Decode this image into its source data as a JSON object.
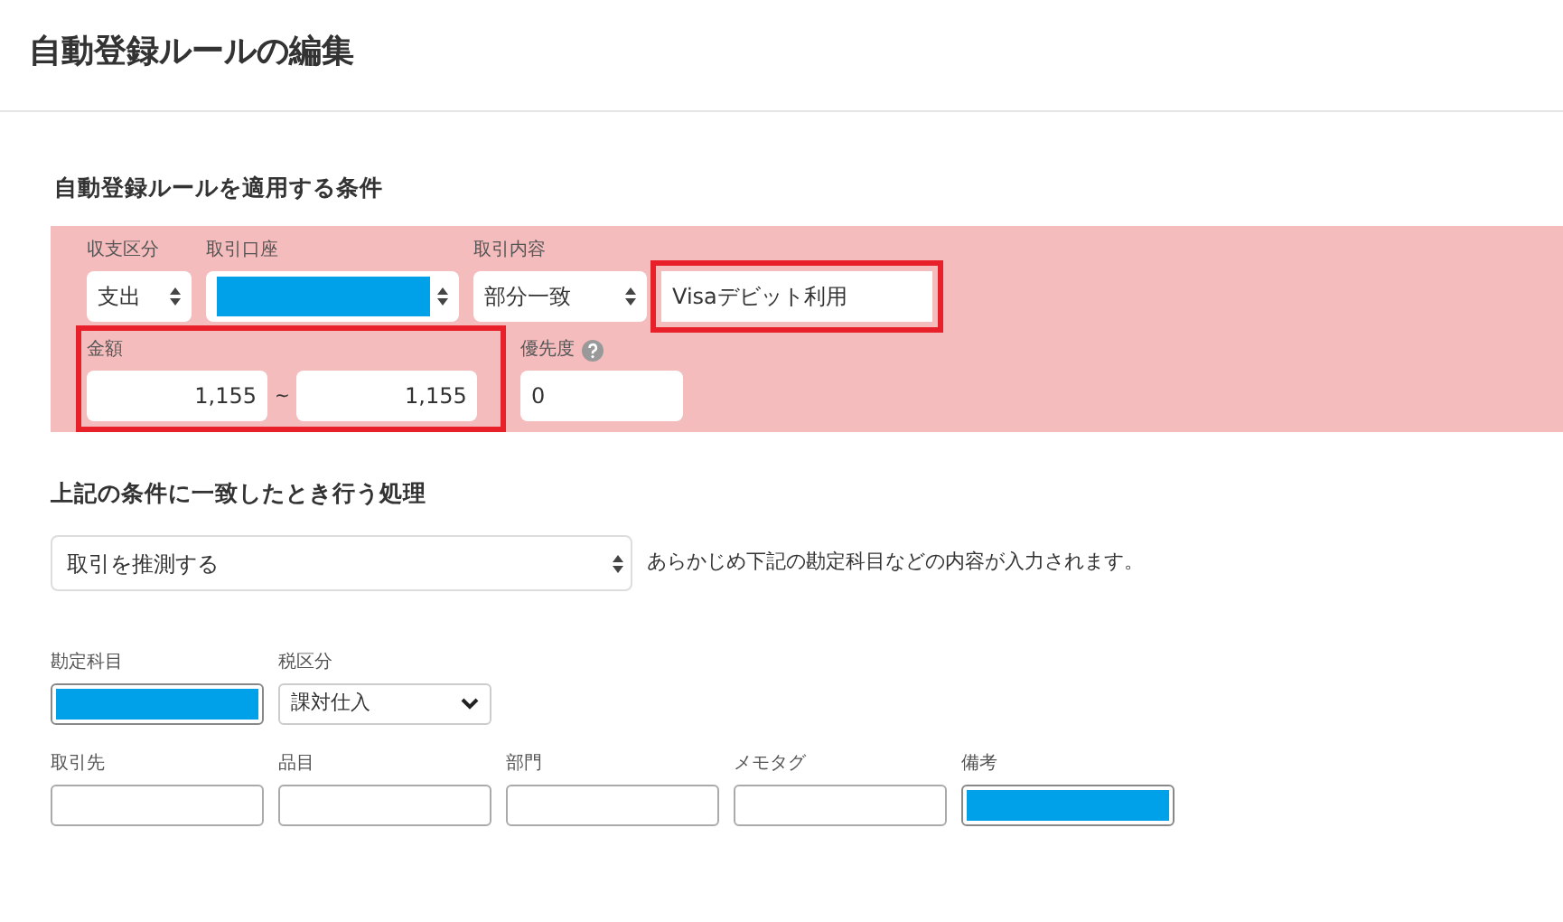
{
  "page_title": "自動登録ルールの編集",
  "conditions": {
    "heading": "自動登録ルールを適用する条件",
    "fields": [
      {
        "label": "収支区分",
        "kind": "select",
        "value": "支出"
      },
      {
        "label": "取引口座",
        "kind": "select",
        "redacted": true
      },
      {
        "label": "取引内容",
        "kind": "select",
        "value": "部分一致"
      },
      {
        "kind": "input",
        "value": "Visaデビット利用",
        "highlighted": true
      }
    ],
    "amount": {
      "label": "金額",
      "min": "1,155",
      "separator": "~",
      "max": "1,155",
      "highlighted": true
    },
    "priority": {
      "label": "優先度",
      "value": "0"
    }
  },
  "action": {
    "heading": "上記の条件に一致したとき行う処理",
    "select": "取引を推測する",
    "hint": "あらかじめ下記の勘定科目などの内容が入力されます。"
  },
  "details": [
    [
      {
        "label": "勘定科目",
        "kind": "input",
        "redacted": true
      },
      {
        "label": "税区分",
        "kind": "dropdown",
        "value": "課対仕入"
      }
    ],
    [
      {
        "label": "取引先",
        "kind": "input"
      },
      {
        "label": "品目",
        "kind": "input"
      },
      {
        "label": "部門",
        "kind": "input"
      },
      {
        "label": "メモタグ",
        "kind": "input"
      },
      {
        "label": "備考",
        "kind": "input",
        "redacted": true
      }
    ]
  ]
}
